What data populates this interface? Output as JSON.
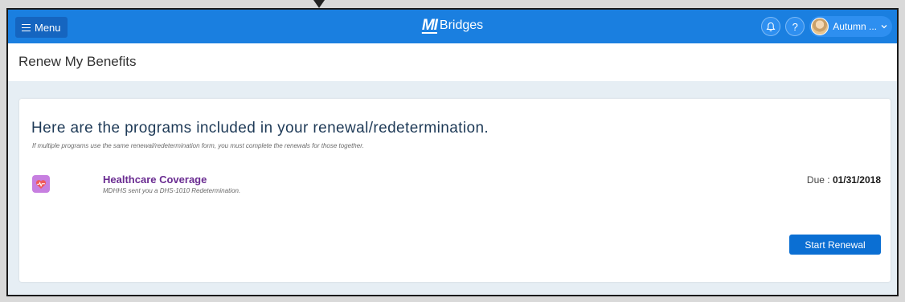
{
  "topbar": {
    "menu_label": "Menu",
    "brand_mark": "MI",
    "brand_name": "Bridges",
    "user_name": "Autumn ..."
  },
  "icons": {
    "menu": "hamburger-icon",
    "notifications": "bell-icon",
    "help": "question-icon",
    "user_dropdown": "chevron-down-icon",
    "program": "heart-pulse-icon"
  },
  "colors": {
    "topbar": "#1a7fe0",
    "program_name": "#6a2c91",
    "program_icon": "#c77fe0",
    "primary_button": "#0b6fd3"
  },
  "page": {
    "title": "Renew My Benefits"
  },
  "card": {
    "heading": "Here are the programs included in your renewal/redetermination.",
    "subtext": "If multiple programs use the same renewal/redetermination form, you must complete the renewals for those together.",
    "program": {
      "name": "Healthcare Coverage",
      "description": "MDHHS sent you a DHS-1010 Redetermination.",
      "due_label": "Due : ",
      "due_date": "01/31/2018"
    },
    "start_button": "Start Renewal"
  }
}
